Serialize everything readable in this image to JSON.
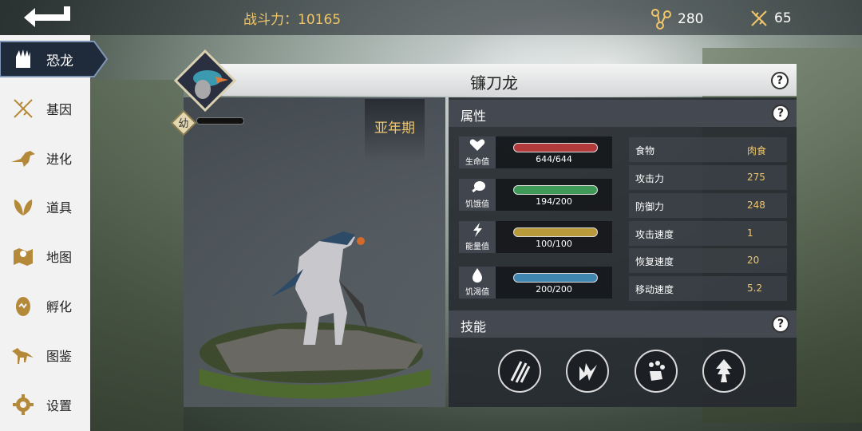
{
  "topbar": {
    "power_label": "战斗力：",
    "power_value": "10165",
    "resource1": "280",
    "resource2": "65"
  },
  "sidebar": {
    "items": [
      {
        "label": "恐龙",
        "icon": "dinosaur-claw-icon"
      },
      {
        "label": "基因",
        "icon": "dna-icon"
      },
      {
        "label": "进化",
        "icon": "evolution-bird-icon"
      },
      {
        "label": "道具",
        "icon": "leaf-icon"
      },
      {
        "label": "地图",
        "icon": "map-icon"
      },
      {
        "label": "孵化",
        "icon": "egg-icon"
      },
      {
        "label": "图鉴",
        "icon": "dinosaur-skeleton-icon"
      },
      {
        "label": "设置",
        "icon": "gear-icon"
      }
    ]
  },
  "dino": {
    "name": "镰刀龙",
    "stage": "亚年期",
    "age_badge": "幼"
  },
  "sections": {
    "attributes": "属性",
    "skills": "技能"
  },
  "stats": [
    {
      "label": "生命值",
      "value": "644/644",
      "color": "#b23a3a",
      "icon": "heart-icon",
      "fill": 1.0
    },
    {
      "label": "饥饿值",
      "value": "194/200",
      "color": "#3f9a57",
      "icon": "drumstick-icon",
      "fill": 0.97
    },
    {
      "label": "能量值",
      "value": "100/100",
      "color": "#b89a3a",
      "icon": "lightning-icon",
      "fill": 1.0
    },
    {
      "label": "饥渴值",
      "value": "200/200",
      "color": "#3f86b0",
      "icon": "water-drop-icon",
      "fill": 1.0
    }
  ],
  "attributes": [
    {
      "key": "食物",
      "value": "肉食"
    },
    {
      "key": "攻击力",
      "value": "275"
    },
    {
      "key": "防御力",
      "value": "248"
    },
    {
      "key": "攻击速度",
      "value": "1"
    },
    {
      "key": "恢复速度",
      "value": "20"
    },
    {
      "key": "移动速度",
      "value": "5.2"
    }
  ],
  "skills": [
    {
      "icon": "claw-slash-icon"
    },
    {
      "icon": "lightning-strike-icon"
    },
    {
      "icon": "paw-shatter-icon"
    },
    {
      "icon": "arrow-up-boost-icon"
    }
  ],
  "colors": {
    "accent_gold": "#f0c66a",
    "panel_dark": "#26292f"
  }
}
